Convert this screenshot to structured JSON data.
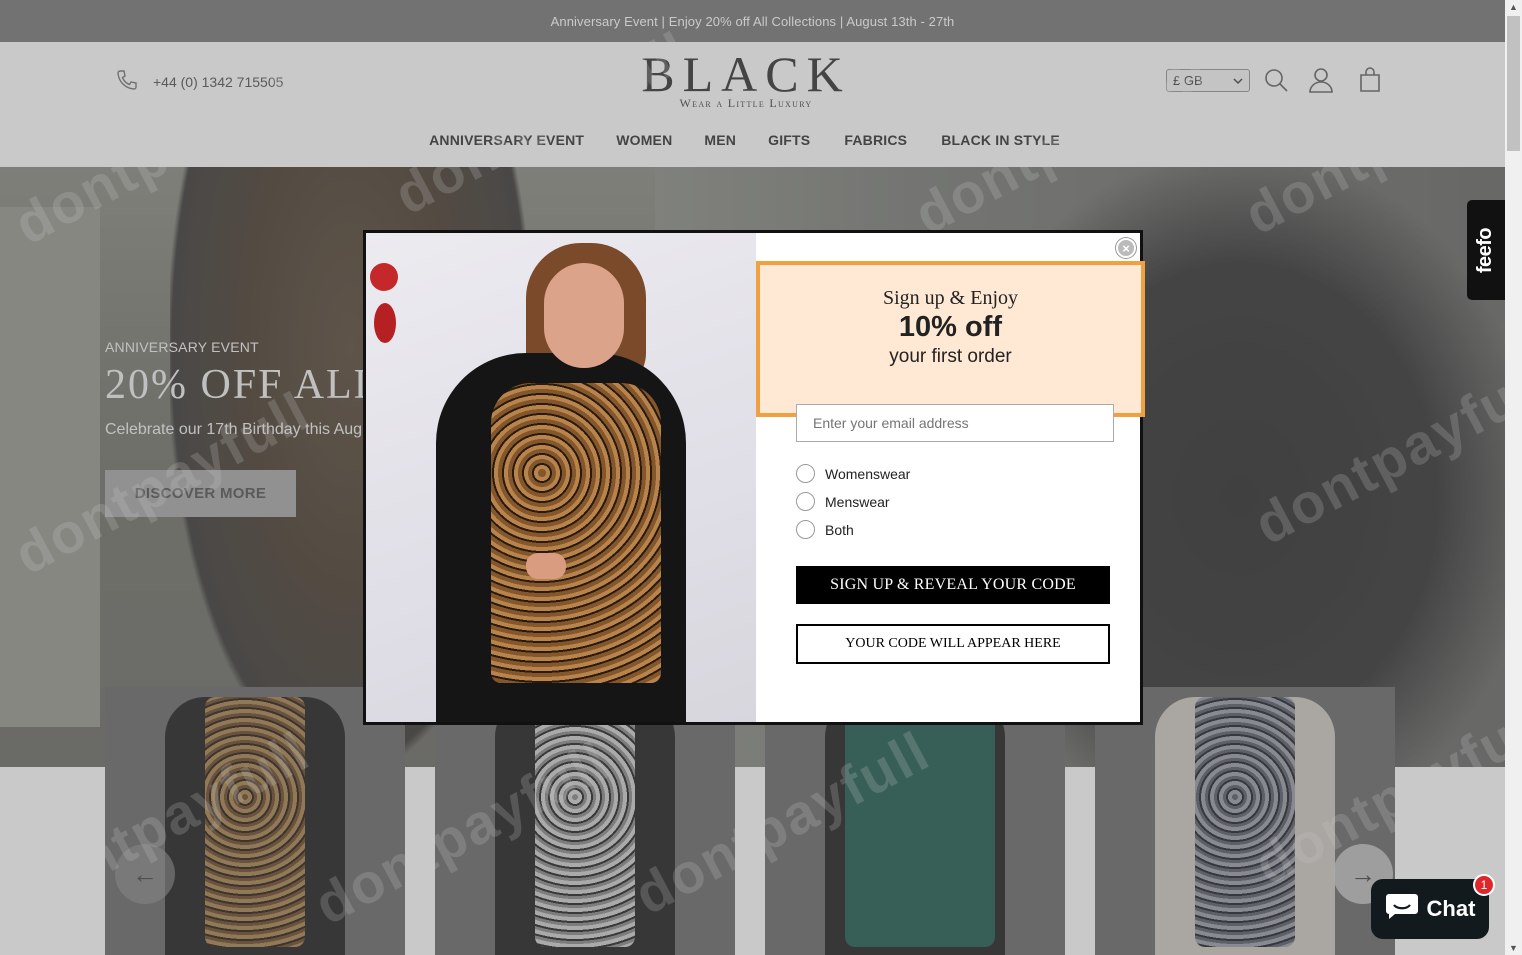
{
  "announcement": {
    "text": "Anniversary Event | Enjoy 20% off All Collections | August 13th - 27th"
  },
  "header": {
    "phone": "+44 (0) 1342 715505",
    "logo": {
      "main": "BLACK",
      "sub": "Wear a Little Luxury"
    },
    "currency": "£ GB",
    "icons": [
      "search-icon",
      "account-icon",
      "cart-icon"
    ]
  },
  "nav": {
    "items": [
      {
        "label": "ANNIVERSARY EVENT"
      },
      {
        "label": "WOMEN"
      },
      {
        "label": "MEN"
      },
      {
        "label": "GIFTS"
      },
      {
        "label": "FABRICS"
      },
      {
        "label": "BLACK IN STYLE"
      }
    ]
  },
  "hero": {
    "eyebrow": "ANNIVERSARY EVENT",
    "title": "20% OFF ALL",
    "subtitle": "Celebrate our 17th Birthday this Aug",
    "button": "DISCOVER MORE"
  },
  "popup": {
    "offer_line1": "Sign up & Enjoy",
    "offer_line2": "10% off",
    "offer_line3": "your first order",
    "email_placeholder": "Enter your email address",
    "options": [
      "Womenswear",
      "Menswear",
      "Both"
    ],
    "submit": "SIGN UP & REVEAL YOUR CODE",
    "code_placeholder": "YOUR CODE WILL APPEAR HERE",
    "highlight_color": "#f0a040"
  },
  "feefo": {
    "label": "feefo"
  },
  "chat": {
    "label": "Chat",
    "badge": "1"
  },
  "watermark": "dontpayfull"
}
